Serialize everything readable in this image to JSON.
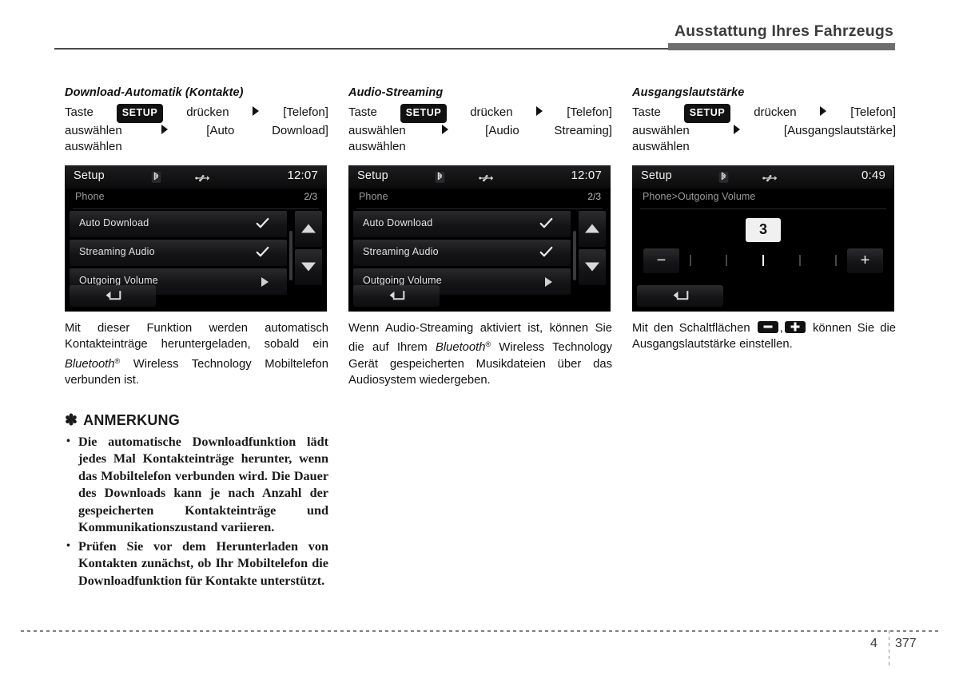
{
  "header": {
    "title": "Ausstattung Ihres Fahrzeugs"
  },
  "footer": {
    "chapter": "4",
    "page": "377"
  },
  "common": {
    "taste_label": "Taste",
    "setup_badge": "SETUP",
    "druecken_label": "drücken",
    "auswaehlen_label": "auswählen",
    "telefon_item": "[Telefon]",
    "arrow_icon": "triangle-right-icon"
  },
  "columns": [
    {
      "id": "download-automatik",
      "title": "Download-Automatik (Kontakte)",
      "path": {
        "line1_a": "Taste",
        "badge": "SETUP",
        "line1_b": "drücken",
        "line1_c": "[Telefon]",
        "line2_a": "auswählen",
        "line2_b": "[Auto",
        "line2_c": "Download]",
        "line3": "auswählen"
      },
      "screen": {
        "type": "list",
        "title": "Setup",
        "clock": "12:07",
        "breadcrumb": "Phone",
        "page_indicator": "2/3",
        "bt_icon": "bluetooth-icon",
        "usb_icon": "usb-icon",
        "rows": [
          {
            "label": "Auto Download",
            "accessory": "check-icon"
          },
          {
            "label": "Streaming Audio",
            "accessory": "check-icon"
          },
          {
            "label": "Outgoing Volume",
            "accessory": "arrow-right-icon"
          }
        ],
        "scroll_up_icon": "caret-up-icon",
        "scroll_down_icon": "caret-down-icon",
        "back_icon": "back-arrow-icon"
      },
      "body": {
        "p1": "Mit dieser Funktion werden automatisch Kontakteinträge heruntergeladen, sobald ein ",
        "brand": "Bluetooth",
        "reg": "®",
        "p2": " Wireless Technology Mobiltelefon verbunden ist."
      }
    },
    {
      "id": "audio-streaming",
      "title": "Audio-Streaming",
      "path": {
        "line1_a": "Taste",
        "badge": "SETUP",
        "line1_b": "drücken",
        "line1_c": "[Telefon]",
        "line2_a": "auswählen",
        "line2_b": "[Audio",
        "line2_c": "Streaming]",
        "line3": "auswählen"
      },
      "screen": {
        "type": "list",
        "title": "Setup",
        "clock": "12:07",
        "breadcrumb": "Phone",
        "page_indicator": "2/3",
        "bt_icon": "bluetooth-icon",
        "usb_icon": "usb-icon",
        "rows": [
          {
            "label": "Auto Download",
            "accessory": "check-icon"
          },
          {
            "label": "Streaming Audio",
            "accessory": "check-icon"
          },
          {
            "label": "Outgoing Volume",
            "accessory": "arrow-right-icon"
          }
        ],
        "scroll_up_icon": "caret-up-icon",
        "scroll_down_icon": "caret-down-icon",
        "back_icon": "back-arrow-icon"
      },
      "body": {
        "p1": "Wenn Audio-Streaming aktiviert ist, können Sie die auf Ihrem ",
        "brand": "Bluetooth",
        "reg": "®",
        "p2": " Wireless Technology Gerät gespeicherten Musikdateien über das Audiosystem wiedergeben."
      }
    },
    {
      "id": "ausgangslautstaerke",
      "title": "Ausgangslautstärke",
      "path": {
        "line1_a": "Taste",
        "badge": "SETUP",
        "line1_b": "drücken",
        "line1_c": "[Telefon]",
        "line2_a": "auswählen",
        "line2_b": "[Ausgangslautstärke]",
        "line2_c": "",
        "line3": "auswählen"
      },
      "screen": {
        "type": "volume",
        "title": "Setup",
        "clock": "0:49",
        "breadcrumb": "Phone>Outgoing Volume",
        "bt_icon": "bluetooth-icon",
        "usb_icon": "usb-icon",
        "value": "3",
        "minus_label": "−",
        "plus_label": "+",
        "ticks_total": 5,
        "tick_active_index": 2,
        "back_icon": "back-arrow-icon"
      },
      "body": {
        "p1": "Mit den Schaltflächen ",
        "minus_icon": "minus-button-icon",
        "sep": ",",
        "plus_icon": "plus-button-icon",
        "p2": " können Sie die Ausgangslautstärke einstellen."
      }
    }
  ],
  "note": {
    "asterisk": "✽",
    "heading": "ANMERKUNG",
    "items": [
      "Die automatische Downloadfunktion lädt jedes Mal Kontakteinträge herunter, wenn das Mobiltelefon verbunden wird. Die Dauer des Downloads kann je nach Anzahl der gespeicherten Kontakteinträge und Kommunikationszustand variieren.",
      "Prüfen Sie vor dem Herunterladen von Kontakten zunächst, ob Ihr Mobiltelefon die Downloadfunktion für Kontakte unterstützt."
    ]
  }
}
